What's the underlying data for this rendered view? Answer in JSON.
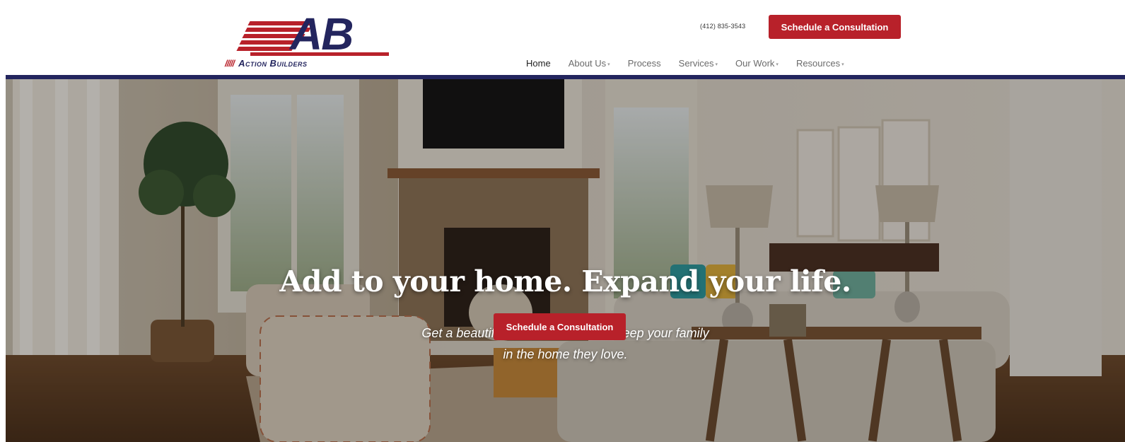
{
  "brand": {
    "logo_letters": "AB",
    "logo_stripes": "/////",
    "logo_name": "Action Builders",
    "brand_red": "#b8212a",
    "brand_navy": "#23255e"
  },
  "header": {
    "phone": "(412) 835-3543",
    "cta_label": "Schedule a Consultation"
  },
  "nav": {
    "items": [
      {
        "label": "Home",
        "active": true,
        "dropdown": false
      },
      {
        "label": "About Us",
        "active": false,
        "dropdown": true
      },
      {
        "label": "Process",
        "active": false,
        "dropdown": false
      },
      {
        "label": "Services",
        "active": false,
        "dropdown": true
      },
      {
        "label": "Our Work",
        "active": false,
        "dropdown": true
      },
      {
        "label": "Resources",
        "active": false,
        "dropdown": true
      }
    ],
    "caret": "▾"
  },
  "hero": {
    "title": "Add to your home. Expand your life.",
    "subtitle_line1": "Get a beautiful home addition and keep your family",
    "subtitle_line2": "in the home they love.",
    "cta_label": "Schedule a Consultation",
    "background_image": "living-room-photo"
  }
}
